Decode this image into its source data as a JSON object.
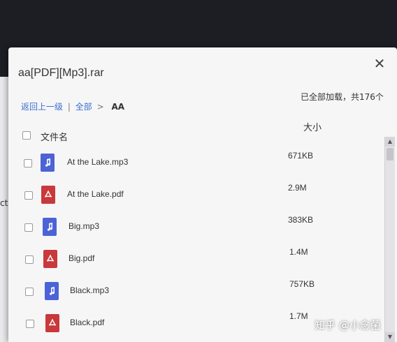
{
  "background": {
    "fragment_text": "ct"
  },
  "dialog": {
    "title": "aa[PDF][Mp3].rar",
    "close_label": "✕",
    "breadcrumb": {
      "back": "返回上一级",
      "separator": "|",
      "root": "全部",
      "arrow": ">",
      "current": "AA"
    },
    "status": "已全部加载，共176个",
    "columns": {
      "name": "文件名",
      "size": "大小"
    },
    "files": [
      {
        "name": "At the Lake.mp3",
        "size": "671KB",
        "type": "mp3",
        "icon": "music-note-icon"
      },
      {
        "name": "At the Lake.pdf",
        "size": "2.9M",
        "type": "pdf",
        "icon": "pdf-icon"
      },
      {
        "name": "Big.mp3",
        "size": "383KB",
        "type": "mp3",
        "icon": "music-note-icon"
      },
      {
        "name": "Big.pdf",
        "size": "1.4M",
        "type": "pdf",
        "icon": "pdf-icon"
      },
      {
        "name": "Black.mp3",
        "size": "757KB",
        "type": "mp3",
        "icon": "music-note-icon"
      },
      {
        "name": "Black.pdf",
        "size": "1.7M",
        "type": "pdf",
        "icon": "pdf-icon"
      }
    ],
    "scrollbar": {
      "up_arrow": "▲",
      "down_arrow": "▼"
    }
  },
  "watermark": "知乎 @小念菌",
  "colors": {
    "mp3_icon": "#4b63d6",
    "pdf_icon": "#c9383b",
    "link": "#3b6fd0"
  }
}
